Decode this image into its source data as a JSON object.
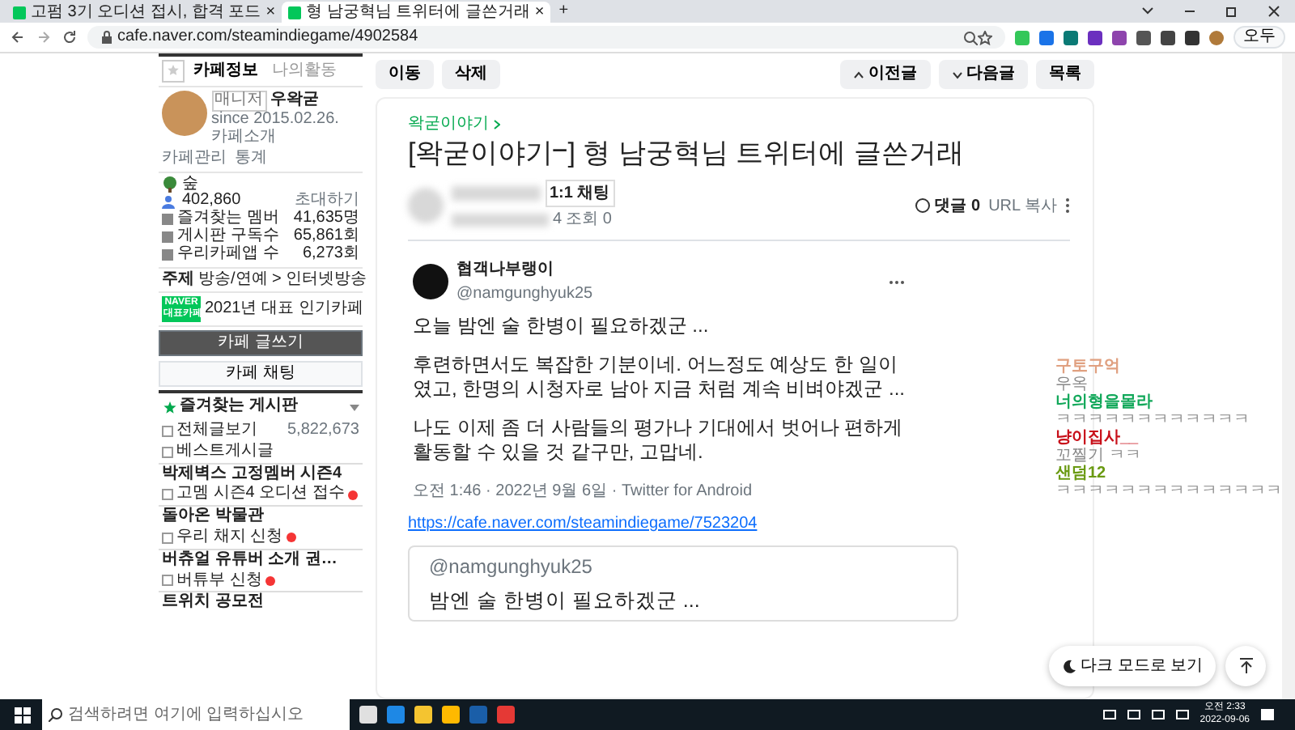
{
  "browser": {
    "tabs": [
      {
        "title": "고펌 3기 오디션 접시, 합격 포드",
        "close": "×",
        "selected": false
      },
      {
        "title": "형 남궁혁님 트위터에 글쓴거래",
        "close": "×",
        "selected": true
      }
    ],
    "new_tab": "+",
    "url": "cafe.naver.com/steamindiegame/4902584",
    "profile_button": "오두"
  },
  "sidebar": {
    "tabs": [
      {
        "label": "카페정보",
        "selected": true
      },
      {
        "label": "나의활동",
        "selected": false
      }
    ],
    "manager_badge": "매니저",
    "cafe_name": "우왁굳",
    "since": "since 2015.02.26.",
    "intro": "카페소개",
    "links": [
      "카페관리",
      "통계"
    ],
    "grade": "숲",
    "members": "402,860",
    "invite": "초대하기",
    "stats": [
      {
        "label": "즐겨찾는 멤버",
        "value": "41,635명"
      },
      {
        "label": "게시판 구독수",
        "value": "65,861회"
      },
      {
        "label": "우리카페앱 수",
        "value": "6,273회"
      }
    ],
    "topic_label": "주제",
    "topic": "방송/연예 > 인터넷방송",
    "naver_badge": [
      "NAVER",
      "대표카페"
    ],
    "award": "2021년 대표 인기카페",
    "write_button": "카페 글쓰기",
    "chat_button": "카페 채팅",
    "boards_title": "즐겨찾는 게시판",
    "boards": [
      {
        "kind": "board",
        "label": "전체글보기",
        "count": "5,822,673",
        "new": false
      },
      {
        "kind": "board",
        "label": "베스트게시글",
        "new": false
      },
      {
        "kind": "header",
        "label": "박제벽스 고정멤버 시즌4",
        "new": false
      },
      {
        "kind": "board",
        "label": "고멤 시즌4 오디션 접수",
        "new": true
      },
      {
        "kind": "header",
        "label": "돌아온 박물관",
        "new": false
      },
      {
        "kind": "board",
        "label": "우리 채지 신청",
        "new": true
      },
      {
        "kind": "header",
        "label": "버츄얼 유튜버 소개 권…",
        "new": false
      },
      {
        "kind": "board",
        "label": "버튜부 신청",
        "new": true
      },
      {
        "kind": "header",
        "label": "트위치 공모전",
        "new": false
      }
    ]
  },
  "toolbar": {
    "left": [
      "이동",
      "삭제"
    ],
    "right": [
      {
        "label": "이전글",
        "kind": "prev"
      },
      {
        "label": "다음글",
        "kind": "next"
      },
      {
        "label": "목록",
        "kind": "list"
      }
    ]
  },
  "article": {
    "category": "왁굳이야기",
    "title": "[왁굳이야기ⲻ] 형 남궁혁님 트위터에 글쓴거래",
    "chat_badge": "1:1 채팅",
    "date_tail": "4",
    "views": "조회 0",
    "comments": "댓글 0",
    "url_copy": "URL 복사",
    "tweet": {
      "name": "협객나부랭이",
      "handle": "@namgunghyuk25",
      "paragraphs": [
        "오늘 밤엔 술 한병이 필요하겠군 ...",
        "후련하면서도 복잡한 기분이네. 어느정도 예상도 한 일이였고, 한명의 시청자로 남아 지금 처럼 계속 비벼야겠군 ...",
        "나도 이제 좀 더 사람들의 평가나 기대에서 벗어나 편하게 활동할 수 있을 것 같구만, 고맙네."
      ],
      "meta": "오전 1:46 · 2022년 9월 6일 · Twitter for Android"
    },
    "link": "https://cafe.naver.com/steamindiegame/7523204",
    "embed": {
      "handle": "@namgunghyuk25",
      "text": "밤엔 술 한병이 필요하겠군 ..."
    }
  },
  "chat": [
    {
      "name": "구토구억",
      "color": "#e0a080",
      "message": "우옥"
    },
    {
      "name": "너의형을몰라",
      "color": "#12a85a",
      "message": "ㅋㅋㅋㅋㅋㅋㅋㅋㅋㅋㅋㅋ"
    },
    {
      "name": "냥이집사__",
      "color": "#c8101a",
      "message": "꼬찔기 ㅋㅋ"
    },
    {
      "name": "샌덤12",
      "color": "#6a9a12",
      "message": "ㅋㅋㅋㅋㅋㅋㅋㅋㅋㅋㅋㅋㅋㅋ"
    }
  ],
  "dark_mode": "다크 모드로 보기",
  "taskbar": {
    "search_placeholder": "검색하려면 여기에 입력하십시오",
    "time": "오전 2:33",
    "date": "2022-09-06"
  }
}
